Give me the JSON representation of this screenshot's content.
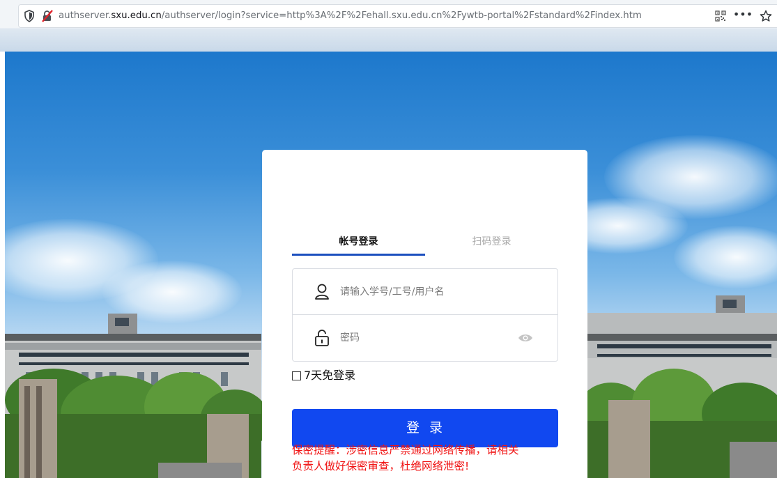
{
  "browser": {
    "url_prefix": "authserver.",
    "url_domain": "sxu.edu.cn",
    "url_rest": "/authserver/login?service=http%3A%2F%2Fehall.sxu.edu.cn%2Fywtb-portal%2Fstandard%2Findex.htm",
    "more_label": "•••"
  },
  "login": {
    "tabs": [
      {
        "label": "帐号登录",
        "active": true
      },
      {
        "label": "扫码登录",
        "active": false
      }
    ],
    "username_placeholder": "请输入学号/工号/用户名",
    "password_placeholder": "密码",
    "remember_label": "7天免登录",
    "submit_label": "登录",
    "warning_line1": "保密提醒：涉密信息严禁通过网络传播，请相关",
    "warning_line2": "负责人做好保密审查，杜绝网络泄密!"
  },
  "colors": {
    "accent": "#1148f0",
    "tab_underline": "#1c4fbf",
    "warning": "#f01212"
  }
}
